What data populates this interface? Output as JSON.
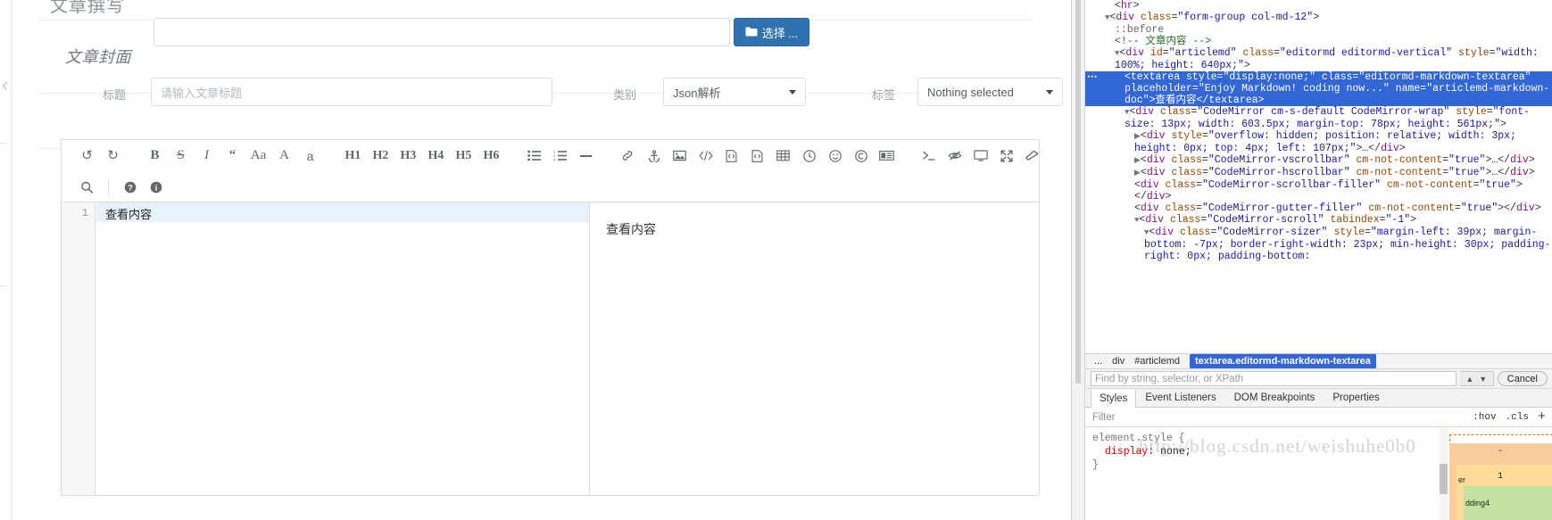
{
  "page": {
    "title": "文章撰写",
    "cover": {
      "label": "文章封面",
      "input_value": "",
      "choose_button": "选择 ...",
      "folder_icon": "folder-icon"
    },
    "fields": {
      "title_label": "标题",
      "title_placeholder": "请输入文章标题",
      "category_label": "类别",
      "category_value": "Json解析",
      "tag_label": "标签",
      "tag_value": "Nothing selected"
    },
    "editor": {
      "toolbar_row1": [
        {
          "name": "undo-icon",
          "glyph": "↺"
        },
        {
          "name": "redo-icon",
          "glyph": "↻"
        },
        {
          "name": "separator",
          "glyph": "|"
        },
        {
          "name": "bold-icon",
          "glyph": "B"
        },
        {
          "name": "strikethrough-icon",
          "glyph": "S"
        },
        {
          "name": "italic-icon",
          "glyph": "I"
        },
        {
          "name": "quote-icon",
          "glyph": "❝"
        },
        {
          "name": "uppercase-icon",
          "glyph": "Aa"
        },
        {
          "name": "font-size-large-icon",
          "glyph": "A"
        },
        {
          "name": "font-size-small-icon",
          "glyph": "a"
        },
        {
          "name": "separator",
          "glyph": "|"
        },
        {
          "name": "heading-1-icon",
          "glyph": "H1"
        },
        {
          "name": "heading-2-icon",
          "glyph": "H2"
        },
        {
          "name": "heading-3-icon",
          "glyph": "H3"
        },
        {
          "name": "heading-4-icon",
          "glyph": "H4"
        },
        {
          "name": "heading-5-icon",
          "glyph": "H5"
        },
        {
          "name": "heading-6-icon",
          "glyph": "H6"
        },
        {
          "name": "separator",
          "glyph": "|"
        },
        {
          "name": "unordered-list-icon",
          "glyph": "list-ul"
        },
        {
          "name": "ordered-list-icon",
          "glyph": "list-ol"
        },
        {
          "name": "horizontal-rule-icon",
          "glyph": "—"
        },
        {
          "name": "separator",
          "glyph": "|"
        },
        {
          "name": "link-icon",
          "glyph": "link"
        },
        {
          "name": "anchor-icon",
          "glyph": "anchor"
        },
        {
          "name": "image-icon",
          "glyph": "picture"
        },
        {
          "name": "code-inline-icon",
          "glyph": "</>"
        },
        {
          "name": "code-block-icon",
          "glyph": "file-code"
        },
        {
          "name": "preformatted-text-icon",
          "glyph": "file-code-2"
        },
        {
          "name": "table-icon",
          "glyph": "table"
        },
        {
          "name": "datetime-icon",
          "glyph": "clock"
        },
        {
          "name": "emoji-icon",
          "glyph": "smile"
        },
        {
          "name": "html-entity-icon",
          "glyph": "copyright"
        },
        {
          "name": "page-break-icon",
          "glyph": "newspaper"
        },
        {
          "name": "separator",
          "glyph": "|"
        },
        {
          "name": "goto-line-icon",
          "glyph": ">_"
        },
        {
          "name": "watch-toggle-icon",
          "glyph": "eye-slash"
        },
        {
          "name": "preview-icon",
          "glyph": "desktop"
        },
        {
          "name": "fullscreen-icon",
          "glyph": "expand"
        },
        {
          "name": "clear-icon",
          "glyph": "eraser"
        }
      ],
      "toolbar_row2": [
        {
          "name": "search-icon",
          "glyph": "search"
        },
        {
          "name": "separator",
          "glyph": "|"
        },
        {
          "name": "help-icon",
          "glyph": "question-circle"
        },
        {
          "name": "info-icon",
          "glyph": "info-circle"
        }
      ],
      "line_number": "1",
      "content": "查看内容",
      "preview_content": "查看内容"
    }
  },
  "devtools": {
    "dom_lines": [
      {
        "indent": 3,
        "html": "<span class='punct'>&lt;</span><span class='tag'>hr</span><span class='punct'>&gt;</span>"
      },
      {
        "indent": 2,
        "html": "<span class='arrow'>▼</span><span class='punct'>&lt;</span><span class='tag'>div</span> <span class='attr'>class</span><span class='punct'>=</span><span class='val'>\"form-group col-md-12\"</span><span class='punct'>&gt;</span>"
      },
      {
        "indent": 3,
        "html": "<span class='pseudo'>::before</span>"
      },
      {
        "indent": 3,
        "html": "<span class='comment'>&lt;!-- 文章内容 --&gt;</span>"
      },
      {
        "indent": 3,
        "html": "<span class='arrow'>▼</span><span class='punct'>&lt;</span><span class='tag'>div</span> <span class='attr'>id</span><span class='punct'>=</span><span class='val'>\"articlemd\"</span> <span class='attr'>class</span><span class='punct'>=</span><span class='val'>\"editormd editormd-vertical\"</span> <span class='attr'>style</span><span class='punct'>=</span><span class='val'>\"width: 100%; height: 640px;\"</span><span class='punct'>&gt;</span>"
      },
      {
        "indent": 4,
        "selected": true,
        "html": "<span class='punct'>&lt;</span><span class='tag'>textarea</span> <span class='attr'>style</span><span class='punct'>=</span><span class='val'>\"display:none;\"</span> <span class='attr'>class</span><span class='punct'>=</span><span class='val'>\"editormd-markdown-textarea\"</span> <span class='attr'>placeholder</span><span class='punct'>=</span><span class='val'>\"Enjoy Markdown! coding now...\"</span> <span class='attr'>name</span><span class='punct'>=</span><span class='val'>\"articlemd-markdown-doc\"</span><span class='punct'>&gt;</span><span class='txt'>查看内容</span><span class='punct'>&lt;/</span><span class='tag'>textarea</span><span class='punct'>&gt;</span>"
      },
      {
        "indent": 4,
        "html": "<span class='arrow'>▼</span><span class='punct'>&lt;</span><span class='tag'>div</span> <span class='attr'>class</span><span class='punct'>=</span><span class='val'>\"CodeMirror cm-s-default CodeMirror-wrap\"</span> <span class='attr'>style</span><span class='punct'>=</span><span class='val'>\"font-size: 13px; width: 603.5px; margin-top: 78px; height: 561px;\"</span><span class='punct'>&gt;</span>"
      },
      {
        "indent": 5,
        "html": "<span class='arrow'>▶</span><span class='punct'>&lt;</span><span class='tag'>div</span> <span class='attr'>style</span><span class='punct'>=</span><span class='val'>\"overflow: hidden; position: relative; width: 3px; height: 0px; top: 4px; left: 107px;\"</span><span class='punct'>&gt;</span><span class='punct'>…&lt;/</span><span class='tag'>div</span><span class='punct'>&gt;</span>"
      },
      {
        "indent": 5,
        "html": "<span class='arrow'>▶</span><span class='punct'>&lt;</span><span class='tag'>div</span> <span class='attr'>class</span><span class='punct'>=</span><span class='val'>\"CodeMirror-vscrollbar\"</span> <span class='attr'>cm-not-content</span><span class='punct'>=</span><span class='val'>\"true\"</span><span class='punct'>&gt;</span><span class='punct'>…&lt;/</span><span class='tag'>div</span><span class='punct'>&gt;</span>"
      },
      {
        "indent": 5,
        "html": "<span class='arrow'>▶</span><span class='punct'>&lt;</span><span class='tag'>div</span> <span class='attr'>class</span><span class='punct'>=</span><span class='val'>\"CodeMirror-hscrollbar\"</span> <span class='attr'>cm-not-content</span><span class='punct'>=</span><span class='val'>\"true\"</span><span class='punct'>&gt;</span><span class='punct'>…&lt;/</span><span class='tag'>div</span><span class='punct'>&gt;</span>"
      },
      {
        "indent": 5,
        "html": "<span class='punct'>&lt;</span><span class='tag'>div</span> <span class='attr'>class</span><span class='punct'>=</span><span class='val'>\"CodeMirror-scrollbar-filler\"</span> <span class='attr'>cm-not-content</span><span class='punct'>=</span><span class='val'>\"true\"</span><span class='punct'>&gt;&lt;/</span><span class='tag'>div</span><span class='punct'>&gt;</span>"
      },
      {
        "indent": 5,
        "html": "<span class='punct'>&lt;</span><span class='tag'>div</span> <span class='attr'>class</span><span class='punct'>=</span><span class='val'>\"CodeMirror-gutter-filler\"</span> <span class='attr'>cm-not-content</span><span class='punct'>=</span><span class='val'>\"true\"</span><span class='punct'>&gt;&lt;/</span><span class='tag'>div</span><span class='punct'>&gt;</span>"
      },
      {
        "indent": 5,
        "html": "<span class='arrow'>▼</span><span class='punct'>&lt;</span><span class='tag'>div</span> <span class='attr'>class</span><span class='punct'>=</span><span class='val'>\"CodeMirror-scroll\"</span> <span class='attr'>tabindex</span><span class='punct'>=</span><span class='val'>\"-1\"</span><span class='punct'>&gt;</span>"
      },
      {
        "indent": 6,
        "html": "<span class='arrow'>▼</span><span class='punct'>&lt;</span><span class='tag'>div</span> <span class='attr'>class</span><span class='punct'>=</span><span class='val'>\"CodeMirror-sizer\"</span> <span class='attr'>style</span><span class='punct'>=</span><span class='val'>\"margin-left: 39px; margin-bottom: -7px; border-right-width: 23px; min-height: 30px; padding-right: 0px; padding-bottom:</span>"
      }
    ],
    "breadcrumb": [
      "...",
      "div",
      "#articlemd",
      "textarea.editormd-markdown-textarea"
    ],
    "breadcrumb_active_index": 3,
    "find": {
      "placeholder": "Find by string, selector, or XPath",
      "prev_icon": "chevron-up-icon",
      "next_icon": "chevron-down-icon",
      "cancel_label": "Cancel"
    },
    "tabs": [
      "Styles",
      "Event Listeners",
      "DOM Breakpoints",
      "Properties"
    ],
    "active_tab": "Styles",
    "filter": {
      "placeholder": "Filter",
      "hov": ":hov",
      "cls": ".cls",
      "plus": "+"
    },
    "styles": {
      "selector": "element.style {",
      "property": "display",
      "value": "none;",
      "close": "}"
    },
    "box_model": {
      "margin_top": "-",
      "border_label": "er",
      "border_value": "1",
      "padding_label": "dding4"
    }
  },
  "watermark": "http://blog.csdn.net/weishuhe0b0",
  "colors": {
    "accent_button": "#2f72b0",
    "devtools_selection": "#3367d6",
    "active_line": "#e8f2fe",
    "inspect_highlight": "#6fa8dc"
  }
}
